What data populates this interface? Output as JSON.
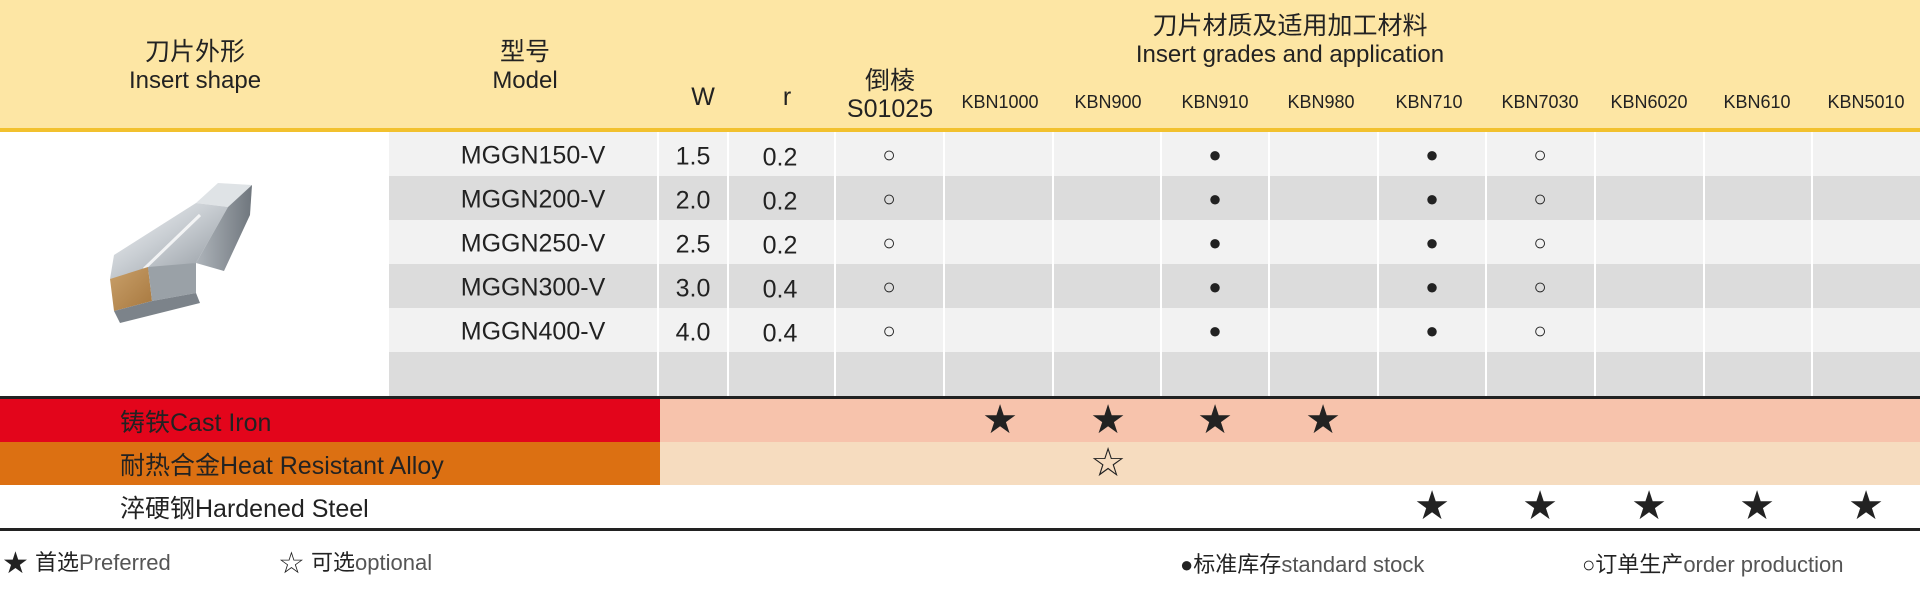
{
  "header": {
    "shape_cn": "刀片外形",
    "shape_en": "Insert shape",
    "model_cn": "型号",
    "model_en": "Model",
    "w": "W",
    "r": "r",
    "chamfer_cn": "倒棱",
    "chamfer_code": "S01025",
    "grades_cn": "刀片材质及适用加工材料",
    "grades_en": "Insert grades and application",
    "grades": [
      "KBN1000",
      "KBN900",
      "KBN910",
      "KBN980",
      "KBN710",
      "KBN7030",
      "KBN6020",
      "KBN610",
      "KBN5010"
    ]
  },
  "rows": [
    {
      "model": "MGGN150-V",
      "w": "1.5",
      "r": "0.2"
    },
    {
      "model": "MGGN200-V",
      "w": "2.0",
      "r": "0.2"
    },
    {
      "model": "MGGN250-V",
      "w": "2.5",
      "r": "0.2"
    },
    {
      "model": "MGGN300-V",
      "w": "3.0",
      "r": "0.4"
    },
    {
      "model": "MGGN400-V",
      "w": "4.0",
      "r": "0.4"
    }
  ],
  "symbols": {
    "open_circle": "○",
    "filled_circle": "●",
    "filled_star": "★",
    "open_star": "☆"
  },
  "colors": {
    "header_bg": "#fde6a4",
    "header_rule": "#f2c12e",
    "row_light": "#f2f2f2",
    "row_dark": "#dcdcdc",
    "cast_iron": "#e3051b",
    "cast_iron_bg": "#f7c3ac",
    "heat_alloy": "#dc7012",
    "heat_alloy_bg": "#f6dcbf"
  },
  "materials": {
    "cast_iron": "铸铁Cast Iron",
    "heat_alloy": "耐热合金Heat Resistant Alloy",
    "hardened_steel": "淬硬钢Hardened Steel"
  },
  "legend": {
    "preferred_cn": "首选",
    "preferred_en": "Preferred",
    "optional_cn": "可选",
    "optional_en": "optional",
    "stock_cn": "标准库存",
    "stock_en": "standard stock",
    "order_cn": "订单生产",
    "order_en": "order production"
  }
}
